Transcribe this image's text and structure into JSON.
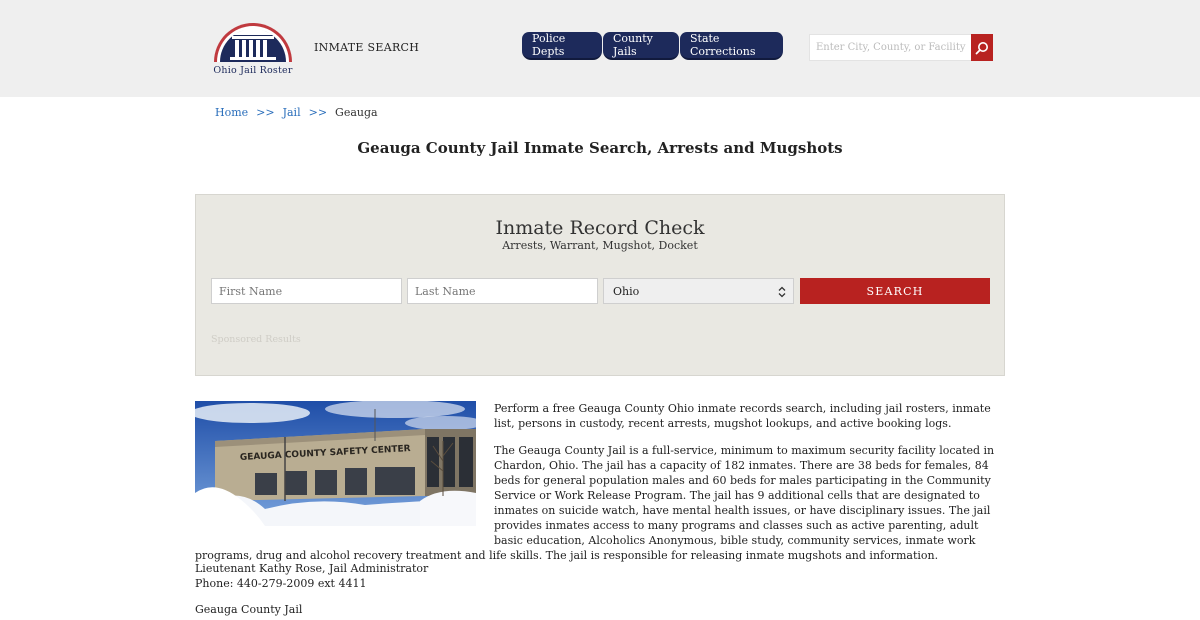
{
  "header": {
    "logo_text": "Ohio Jail Roster",
    "inmate_search_label": "INMATE SEARCH",
    "nav": [
      {
        "label": "Police Depts"
      },
      {
        "label": "County Jails"
      },
      {
        "label": "State Corrections"
      }
    ],
    "search_placeholder": "Enter City, County, or Facility",
    "search_icon": "magnifier-icon"
  },
  "breadcrumb": {
    "items": [
      "Home",
      "Jail"
    ],
    "separator": ">>",
    "current": "Geauga"
  },
  "page_title": "Geauga County Jail Inmate Search, Arrests and Mugshots",
  "record_check": {
    "title": "Inmate Record Check",
    "subtitle": "Arrests, Warrant, Mugshot, Docket",
    "first_name_placeholder": "First Name",
    "last_name_placeholder": "Last Name",
    "state_selected": "Ohio",
    "search_button": "SEARCH",
    "sponsored": "Sponsored Results"
  },
  "photo": {
    "sign_text": "GEAUGA COUNTY SAFETY CENTER"
  },
  "content": {
    "para1": "Perform a free Geauga County Ohio inmate records search, including jail rosters, inmate list, persons in custody, recent arrests, mugshot lookups, and active booking logs.",
    "para2": "The Geauga County Jail is a full-service, minimum to maximum security facility located in Chardon, Ohio. The jail has a capacity of 182 inmates. There are 38 beds for females, 84 beds for general population males and 60 beds for males participating in the Community Service or Work Release Program. The jail has 9 additional cells that are designated to inmates on suicide watch, have mental health issues, or have disciplinary issues. The jail provides inmates access to many programs and classes such as active parenting, adult basic education, Alcoholics Anonymous, bible study, community services, inmate work programs, drug and alcohol recovery treatment and life skills. The jail is responsible for releasing inmate mugshots and information.",
    "contact_name": "Lieutenant Kathy Rose, Jail Administrator",
    "contact_phone": "Phone: 440-279-2009 ext 4411",
    "jail_name": "Geauga County Jail"
  },
  "colors": {
    "nav_bg": "#1d2a5b",
    "accent_red": "#b82220",
    "link_blue": "#2a6ebb",
    "panel_bg": "#e9e8e2",
    "header_bg": "#efefef"
  }
}
